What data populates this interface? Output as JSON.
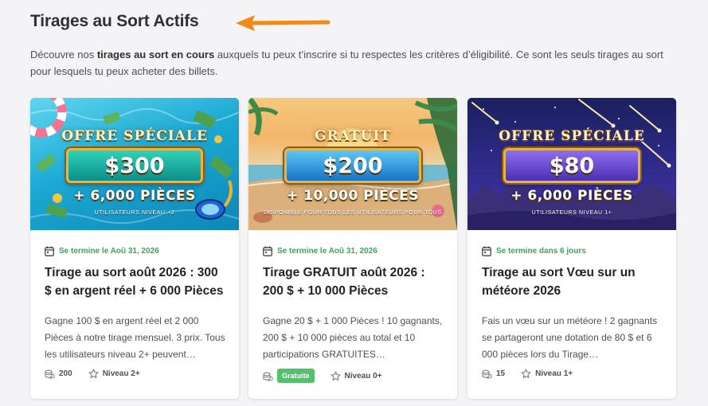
{
  "header": {
    "title": "Tirages au Sort Actifs",
    "intro_start": "Découvre nos ",
    "intro_bold": "tirages au sort en cours",
    "intro_end": " auxquels tu peux t’inscrire si tu respectes les critères d’éligibilité. Ce sont les seuls tirages au sort pour lesquels tu peux acheter des billets."
  },
  "colors": {
    "accent_orange": "#f28a1a",
    "ending_green": "#3aa856",
    "badge_green": "#51c26b"
  },
  "cards": [
    {
      "banner": {
        "headline": "OFFRE SPÉCIALE",
        "amount": "$300",
        "coins": "+ 6,000 PIÈCES",
        "subtitle": "UTILISATEURS NIVEAU +2"
      },
      "ends": "Se termine le Aoû 31, 2026",
      "title": "Tirage au sort août 2026 : 300 $ en argent réel + 6 000 Pièces",
      "description": "Gagne 100 $ en argent réel et 2 000 Pièces à notre tirage mensuel. 3 prix. Tous les utilisateurs niveau 2+ peuvent…",
      "cost": "200",
      "level": "Niveau 2+"
    },
    {
      "banner": {
        "headline": "GRATUIT",
        "amount": "$200",
        "coins": "+ 10,000 PIÈCES",
        "subtitle": "DISPONIBLE POUR TOUS LES UTILISATEURS POUR TOUS"
      },
      "ends": "Se termine le Aoû 31, 2026",
      "title": "Tirage GRATUIT août 2026 : 200 $ + 10 000 Pièces",
      "description": "Gagne 20 $ + 1 000 Pièces ! 10 gagnants, 200 $ + 10 000 pièces au total et 10 participations GRATUITES…",
      "badge": "Gratuite",
      "level": "Niveau 0+"
    },
    {
      "banner": {
        "headline": "OFFRE SPÉCIALE",
        "amount": "$80",
        "coins": "+ 6,000 PIÈCES",
        "subtitle": "UTILISATEURS NIVEAU 1+"
      },
      "ends": "Se termine dans 6 jours",
      "title": "Tirage au sort Vœu sur un météore 2026",
      "description": "Fais un vœu sur un météore ! 2 gagnants se partageront une dotation de 80 $ et 6 000 pièces lors du Tirage…",
      "cost": "15",
      "level": "Niveau 1+"
    }
  ]
}
